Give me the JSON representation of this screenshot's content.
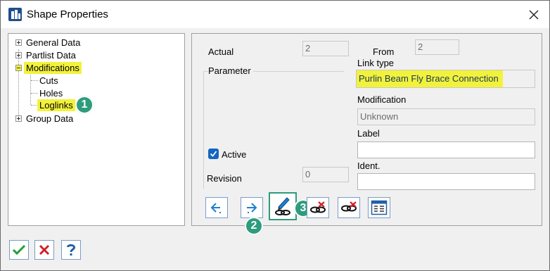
{
  "window": {
    "title": "Shape Properties"
  },
  "tree": {
    "items": [
      {
        "label": "General Data"
      },
      {
        "label": "Partlist Data"
      },
      {
        "label": "Modifications"
      },
      {
        "label": "Cuts"
      },
      {
        "label": "Holes"
      },
      {
        "label": "Loglinks"
      },
      {
        "label": "Group Data"
      }
    ]
  },
  "badges": [
    "1",
    "2",
    "3"
  ],
  "form": {
    "actual_label": "Actual",
    "actual_value": "2",
    "from_label": "From",
    "from_value": "2",
    "parameter_label": "Parameter",
    "active_label": "Active",
    "active_checked": true,
    "revision_label": "Revision",
    "revision_value": "0",
    "link_type_label": "Link type",
    "link_type_value": "Purlin Beam Fly Brace Connection",
    "modification_label": "Modification",
    "modification_value": "Unknown",
    "label_label": "Label",
    "label_value": "",
    "ident_label": "Ident.",
    "ident_value": ""
  },
  "toolbar": {
    "buttons": [
      "previous-arrow-icon",
      "next-arrow-icon",
      "edit-link-icon",
      "delete-link-icon",
      "remove-link-icon",
      "table-icon"
    ]
  },
  "footer": {
    "buttons": [
      "ok-check-icon",
      "cancel-x-icon",
      "help-question-icon"
    ]
  },
  "colors": {
    "highlight": "#f2f23c",
    "badge": "#2e9c7c",
    "checkbox": "#1565c0"
  }
}
